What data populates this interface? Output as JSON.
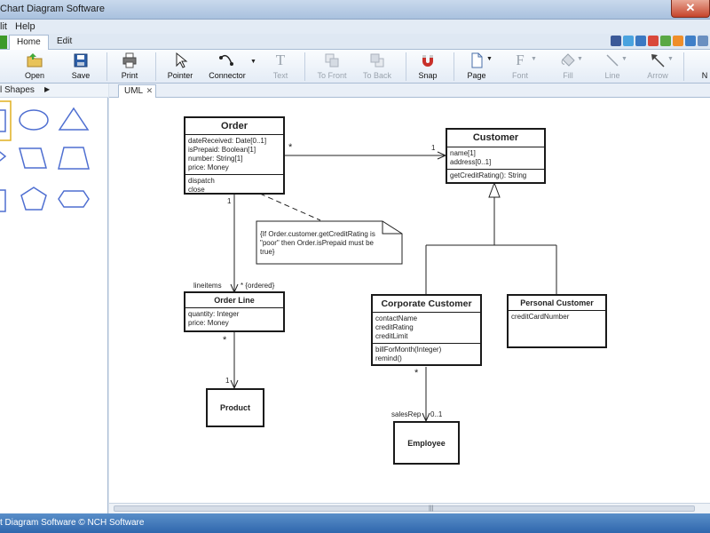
{
  "window": {
    "title": "Chart Diagram Software",
    "close_symbol": "✕"
  },
  "menubar": [
    "lit",
    "Help"
  ],
  "ribbon_tabs": [
    "Home",
    "Edit"
  ],
  "toolbar": {
    "open": "Open",
    "save": "Save",
    "print": "Print",
    "pointer": "Pointer",
    "connector": "Connector",
    "text": "Text",
    "to_front": "To Front",
    "to_back": "To Back",
    "snap": "Snap",
    "page": "Page",
    "font": "Font",
    "fill": "Fill",
    "line": "Line",
    "arrow": "Arrow",
    "more": "N"
  },
  "shapes_panel": {
    "label": "l Shapes",
    "arrow": "▶"
  },
  "document_tab": {
    "label": "UML",
    "close": "✕"
  },
  "diagram": {
    "order": {
      "name": "Order",
      "attributes": [
        "dateReceived: Date[0..1]",
        "isPrepaid: Boolean[1]",
        "number: String[1]",
        "price: Money"
      ],
      "operations": [
        "dispatch",
        "close"
      ]
    },
    "customer": {
      "name": "Customer",
      "attributes": [
        "name[1]",
        "address[0..1]"
      ],
      "operations": [
        "getCreditRating(): String"
      ]
    },
    "order_line": {
      "name": "Order Line",
      "attributes": [
        "quantity: Integer",
        "price: Money"
      ]
    },
    "corporate_customer": {
      "name": "Corporate Customer",
      "attributes": [
        "contactName",
        "creditRating",
        "creditLimit"
      ],
      "operations": [
        "billForMonth(Integer)",
        "remind()"
      ]
    },
    "personal_customer": {
      "name": "Personal Customer",
      "attributes": [
        "creditCardNumber"
      ]
    },
    "product": {
      "name": "Product"
    },
    "employee": {
      "name": "Employee"
    },
    "note": [
      "{If Order.customer.getCreditRating is",
      "\"poor\" then Order.isPrepaid must be",
      "true}"
    ],
    "multiplicities": {
      "order_customer_star": "*",
      "order_customer_one": "1",
      "order_line_one": "1",
      "lineitems": "lineitems",
      "ordered": "* {ordered}",
      "line_product_star": "*",
      "line_product_one": "1",
      "corp_emp_star": "*",
      "salesrep": "salesRep",
      "zero_one": "0..1"
    }
  },
  "statusbar": {
    "text": "t Diagram Software © NCH Software"
  },
  "colors": {
    "shape_stroke": "#4f6fd1",
    "selected_border": "#e0b020",
    "status_bg": "#2f67ad"
  }
}
